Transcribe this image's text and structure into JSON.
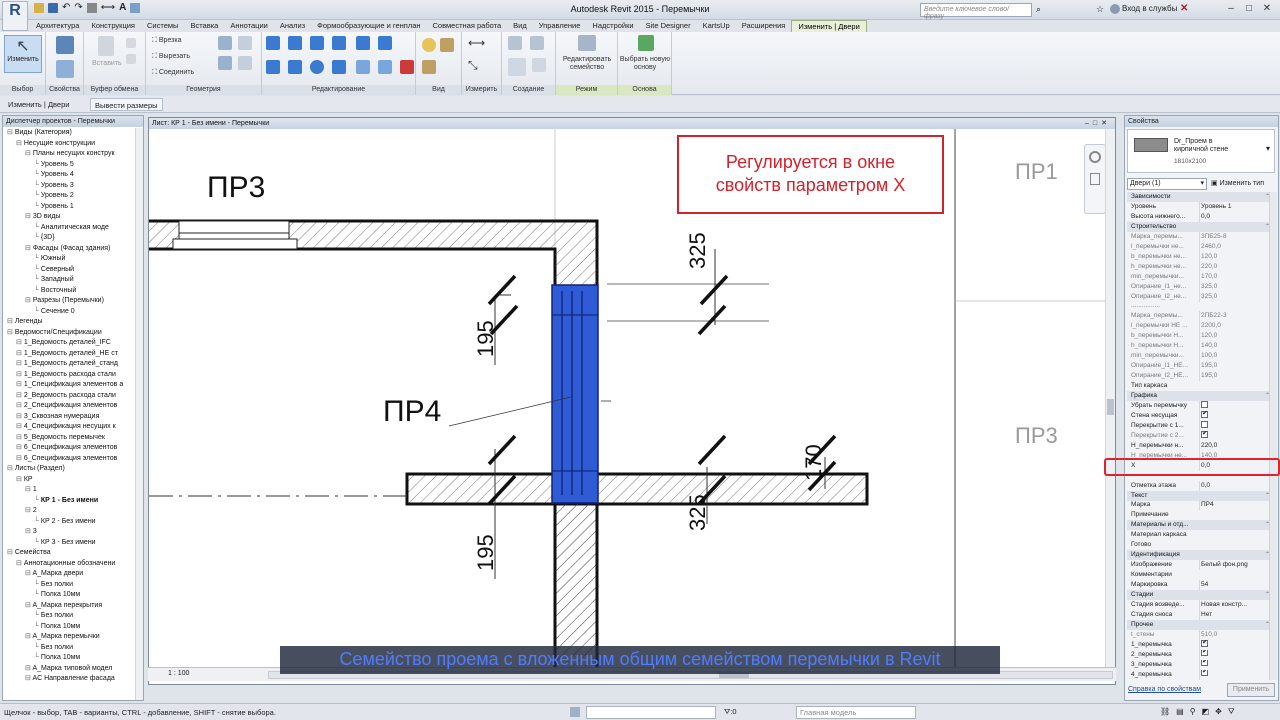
{
  "app": {
    "title": "Autodesk Revit 2015 -    Перемычки",
    "logo": "R",
    "search_placeholder": "Введите ключевое слово/фразу",
    "login": "Вход в службы"
  },
  "tabs": [
    "Архитектура",
    "Конструкция",
    "Системы",
    "Вставка",
    "Аннотации",
    "Анализ",
    "Формообразующие и генплан",
    "Совместная работа",
    "Вид",
    "Управление",
    "Надстройки",
    "Site Designer",
    "KartsUp",
    "Расширения",
    "Изменить | Двери"
  ],
  "ribbon": {
    "modify": "Изменить",
    "insert": "Вставить",
    "cut_geom": "Врезка",
    "cut": "Вырезать",
    "join": "Соединить",
    "edit_family": "Редактировать семейство",
    "pick_host": "Выбрать новую основу",
    "panels": [
      "Выбор",
      "Свойства",
      "Буфер обмена",
      "Геометрия",
      "Редактирование",
      "Вид",
      "Измерить",
      "Создание",
      "Режим",
      "Основа"
    ]
  },
  "context": {
    "label": "Изменить | Двери",
    "dim_button": "Вывести размеры"
  },
  "browser": {
    "title": "Диспетчер проектов - Перемычки",
    "items": [
      {
        "t": "Виды (Категория)",
        "l": 0
      },
      {
        "t": "Несущие конструкции",
        "l": 1
      },
      {
        "t": "Планы несущих конструк",
        "l": 2
      },
      {
        "t": "Уровень 5",
        "l": 3
      },
      {
        "t": "Уровень 4",
        "l": 3
      },
      {
        "t": "Уровень 3",
        "l": 3
      },
      {
        "t": "Уровень 2",
        "l": 3
      },
      {
        "t": "Уровень 1",
        "l": 3
      },
      {
        "t": "3D виды",
        "l": 2
      },
      {
        "t": "Аналитическая моде",
        "l": 3
      },
      {
        "t": "{3D}",
        "l": 3
      },
      {
        "t": "Фасады (Фасад здания)",
        "l": 2
      },
      {
        "t": "Южный",
        "l": 3
      },
      {
        "t": "Северный",
        "l": 3
      },
      {
        "t": "Западный",
        "l": 3
      },
      {
        "t": "Восточный",
        "l": 3
      },
      {
        "t": "Разрезы (Перемычки)",
        "l": 2
      },
      {
        "t": "Сечение 0",
        "l": 3
      },
      {
        "t": "Легенды",
        "l": 0
      },
      {
        "t": "Ведомости/Спецификации",
        "l": 0
      },
      {
        "t": "1_Ведомость деталей_IFC",
        "l": 1
      },
      {
        "t": "1_Ведомость деталей_НЕ ст",
        "l": 1
      },
      {
        "t": "1_Ведомость деталей_станд",
        "l": 1
      },
      {
        "t": "1_Ведомость расхода стали",
        "l": 1
      },
      {
        "t": "1_Спецификация элементов а",
        "l": 1
      },
      {
        "t": "2_Ведомость расхода стали",
        "l": 1
      },
      {
        "t": "2_Спецификация элементов",
        "l": 1
      },
      {
        "t": "3_Сквозная нумерация",
        "l": 1
      },
      {
        "t": "4_Спецификация несущих к",
        "l": 1
      },
      {
        "t": "5_Ведомость перемычек",
        "l": 1
      },
      {
        "t": "6_Спецификация элементов",
        "l": 1
      },
      {
        "t": "6_Спецификация элементов",
        "l": 1
      },
      {
        "t": "Листы (Раздел)",
        "l": 0
      },
      {
        "t": "КР",
        "l": 1
      },
      {
        "t": "1",
        "l": 2
      },
      {
        "t": "КР 1 - Без имени",
        "l": 3,
        "b": true
      },
      {
        "t": "2",
        "l": 2
      },
      {
        "t": "КР 2 - Без имени",
        "l": 3
      },
      {
        "t": "3",
        "l": 2
      },
      {
        "t": "КР 3 - Без имени",
        "l": 3
      },
      {
        "t": "Семейства",
        "l": 0
      },
      {
        "t": "Аннотационные обозначени",
        "l": 1
      },
      {
        "t": "A_Марка двери",
        "l": 2
      },
      {
        "t": "Без полки",
        "l": 3
      },
      {
        "t": "Полка 10мм",
        "l": 3
      },
      {
        "t": "A_Марка перекрытия",
        "l": 2
      },
      {
        "t": "Без полки",
        "l": 3
      },
      {
        "t": "Полка 10мм",
        "l": 3
      },
      {
        "t": "A_Марка перемычки",
        "l": 2
      },
      {
        "t": "Без полки",
        "l": 3
      },
      {
        "t": "Полка 10мм",
        "l": 3
      },
      {
        "t": "A_Марка типовой модел",
        "l": 2
      },
      {
        "t": "AC Направление фасада",
        "l": 2
      }
    ]
  },
  "view": {
    "title": "Лист: КР 1 - Без имени - Перемычки",
    "scale": "1 : 100",
    "labels": {
      "pr3": "ПР3",
      "pr4": "ПР4",
      "pr1": "ПР1",
      "pr3b": "ПР3"
    },
    "dims": {
      "d325a": "325",
      "d195a": "195",
      "d325b": "325",
      "d195b": "195",
      "d170": "170"
    }
  },
  "callout": {
    "line1": "Регулируется в окне",
    "line2": "свойств параметром Х"
  },
  "caption": "Семейство проема с вложенным общим семейством перемычки в Revit",
  "props": {
    "title": "Свойства",
    "type_name": "Dr_Проем в кирпичной стене",
    "type_size": "1810x2100",
    "selector": "Двери (1)",
    "edit_type": "Изменить тип",
    "rows": [
      {
        "g": "Зависимости"
      },
      {
        "n": "Уровень",
        "v": "Уровень 1"
      },
      {
        "n": "Высота нижнего...",
        "v": "0,0"
      },
      {
        "g": "Строительство"
      },
      {
        "n": "Марка_перемы...",
        "v": "3ПБ25-8",
        "grey": true
      },
      {
        "n": "l_перемычки не...",
        "v": "2460,0",
        "grey": true
      },
      {
        "n": "b_перемычки не...",
        "v": "120,0",
        "grey": true
      },
      {
        "n": "h_перемычки не...",
        "v": "220,0",
        "grey": true
      },
      {
        "n": "min_перемычки...",
        "v": "170,0",
        "grey": true
      },
      {
        "n": "Опирание_l1_не...",
        "v": "325,0",
        "grey": true
      },
      {
        "n": "Опирание_l2_не...",
        "v": "325,0",
        "grey": true
      },
      {
        "n": "................",
        "v": "",
        "grey": true
      },
      {
        "n": "Марка_перемы...",
        "v": "2ПБ22-3",
        "grey": true
      },
      {
        "n": "l_перемычки НЕ ...",
        "v": "2200,0",
        "grey": true
      },
      {
        "n": "b_перемычки Н...",
        "v": "120,0",
        "grey": true
      },
      {
        "n": "h_перемычки Н...",
        "v": "140,0",
        "grey": true
      },
      {
        "n": "min_перемычки...",
        "v": "100,0",
        "grey": true
      },
      {
        "n": "Опирание_l1_НЕ...",
        "v": "195,0",
        "grey": true
      },
      {
        "n": "Опирание_l2_НЕ...",
        "v": "195,0",
        "grey": true
      },
      {
        "n": "Тип каркаса",
        "v": ""
      },
      {
        "g": "Графика"
      },
      {
        "n": "Убрать перемычку",
        "v": "",
        "c": false
      },
      {
        "n": "Стена несущая",
        "v": "",
        "c": true
      },
      {
        "n": "Перекрытие с 1...",
        "v": "",
        "c": false
      },
      {
        "n": "Перекрытие с 2...",
        "v": "",
        "c": true,
        "grey": true
      },
      {
        "n": "H_перемычки н...",
        "v": "220,0"
      },
      {
        "n": "H_перемычки не...",
        "v": "140,0",
        "grey": true
      },
      {
        "n": "X",
        "v": "0,0"
      },
      {
        "n": "",
        "v": ""
      },
      {
        "n": "Отметка этажа",
        "v": "0,0"
      },
      {
        "g": "Текст"
      },
      {
        "n": "Марка",
        "v": "ПР4"
      },
      {
        "n": "Примечание",
        "v": ""
      },
      {
        "g": "Материалы и отд..."
      },
      {
        "n": "Материал каркаса",
        "v": ""
      },
      {
        "n": "Готово",
        "v": ""
      },
      {
        "g": "Идентификация"
      },
      {
        "n": "Изображение",
        "v": "Белый фон.png"
      },
      {
        "n": "Комментарии",
        "v": ""
      },
      {
        "n": "Маркировка",
        "v": "54"
      },
      {
        "g": "Стадии"
      },
      {
        "n": "Стадия возведе...",
        "v": "Новая констр..."
      },
      {
        "n": "Стадия сноса",
        "v": "Нет"
      },
      {
        "g": "Прочее"
      },
      {
        "n": "t_стены",
        "v": "510,0",
        "grey": true
      },
      {
        "n": "1_перемычка",
        "v": "",
        "c": true
      },
      {
        "n": "2_перемычка",
        "v": "",
        "c": true
      },
      {
        "n": "3_перемычка",
        "v": "",
        "c": true
      },
      {
        "n": "4_перемычка",
        "v": "",
        "c": true
      }
    ],
    "help": "Справка по свойствам",
    "apply": "Применить"
  },
  "status": {
    "hint": "Щелчок - выбор, TAB - варианты, CTRL - добавление, SHIFT - снятие выбора.",
    "zero": ":0",
    "model": "Главная модель"
  }
}
